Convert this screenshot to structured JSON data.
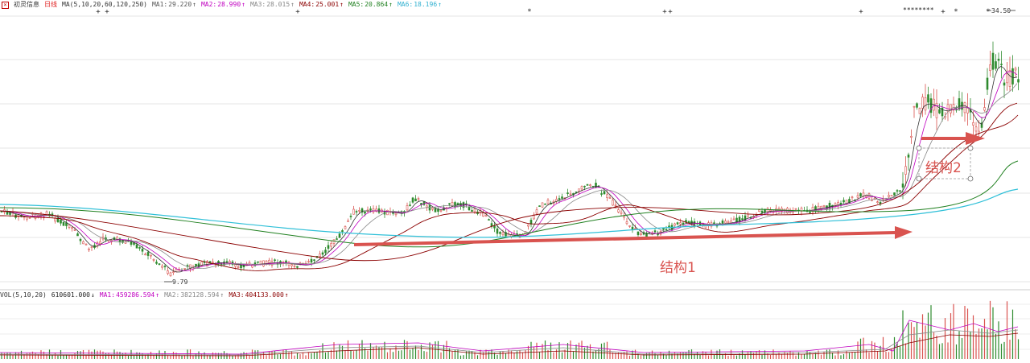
{
  "stock": {
    "name": "初灵信息",
    "period": "日线"
  },
  "price_legend": {
    "prefix": "MA(5,10,20,60,120,250)",
    "items": [
      {
        "label": "MA1:",
        "value": "29.220",
        "arrow": "↑",
        "color": "#555555"
      },
      {
        "label": "MA2:",
        "value": "28.990",
        "arrow": "↑",
        "color": "#c000c0"
      },
      {
        "label": "MA3:",
        "value": "28.015",
        "arrow": "↑",
        "color": "#888888"
      },
      {
        "label": "MA4:",
        "value": "25.001",
        "arrow": "↑",
        "color": "#8b0000"
      },
      {
        "label": "MA5:",
        "value": "20.864",
        "arrow": "↑",
        "color": "#208020"
      },
      {
        "label": "MA6:",
        "value": "18.196",
        "arrow": "↑",
        "color": "#30b0d0"
      }
    ]
  },
  "volume_legend": {
    "prefix": "VOL(5,10,20)",
    "current": "610601.000",
    "current_arrow": "↓",
    "items": [
      {
        "label": "MA1:",
        "value": "459286.594",
        "arrow": "↑",
        "color": "#c000c0"
      },
      {
        "label": "MA2:",
        "value": "382128.594",
        "arrow": "↑",
        "color": "#888888"
      },
      {
        "label": "MA3:",
        "value": "404133.000",
        "arrow": "↑",
        "color": "#8b0000"
      }
    ]
  },
  "price_markers": {
    "low_label": "9.79",
    "high_label": "34.50"
  },
  "annotations": {
    "structure1": "结构1",
    "structure2": "结构2"
  },
  "colors": {
    "up": "#d9534f",
    "down": "#2e8b2e",
    "arrow": "#d9534f",
    "grid": "#e6e6e6"
  }
}
